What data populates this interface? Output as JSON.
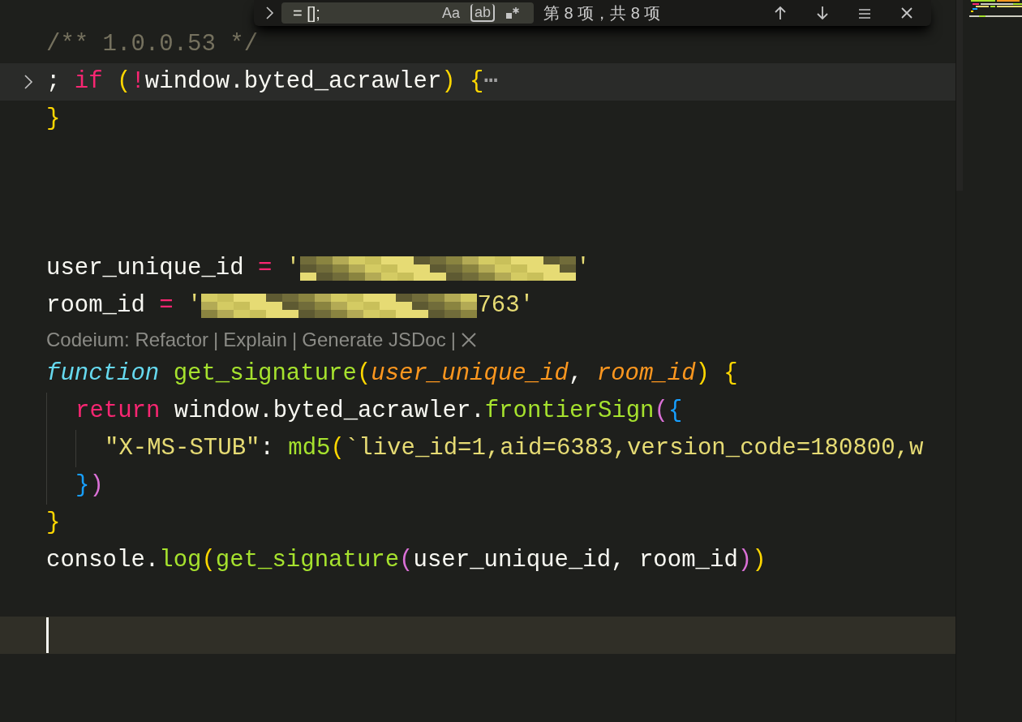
{
  "find_widget": {
    "query": "= [];",
    "options": [
      {
        "kind": "case",
        "label": "Aa",
        "selected": false
      },
      {
        "kind": "word",
        "label": "ab",
        "selected": false
      },
      {
        "kind": "regex",
        "selected": false
      }
    ],
    "result": "第 8 项，共 8 项"
  },
  "lines": [
    {
      "kind": "code",
      "tokens": [
        {
          "kind": "comment",
          "text": "/** 1.0.0.53 */"
        }
      ]
    },
    {
      "kind": "code",
      "folded": true,
      "highlight": true,
      "tokens": [
        {
          "kind": "plain",
          "text": "; "
        },
        {
          "kind": "keyword",
          "text": "if"
        },
        {
          "kind": "brace1",
          "text": " ("
        },
        {
          "kind": "keyword",
          "text": "!"
        },
        {
          "kind": "plain",
          "text": "window.byted_acrawler"
        },
        {
          "kind": "brace1",
          "text": ")"
        },
        {
          "kind": "brace1",
          "text": " {"
        },
        {
          "kind": "ellipsis",
          "text": "⋯"
        }
      ]
    },
    {
      "kind": "code",
      "tokens": [
        {
          "kind": "brace1",
          "text": "}"
        }
      ]
    },
    {
      "kind": "blank"
    },
    {
      "kind": "blank"
    },
    {
      "kind": "blank"
    },
    {
      "kind": "code",
      "tokens": [
        {
          "kind": "plain",
          "text": "user_unique_id "
        },
        {
          "kind": "keyword",
          "text": "="
        },
        {
          "kind": "string",
          "text": " '"
        },
        {
          "kind": "redacted"
        },
        {
          "kind": "string",
          "text": "'"
        }
      ]
    },
    {
      "kind": "code",
      "tokens": [
        {
          "kind": "plain",
          "text": "room_id "
        },
        {
          "kind": "keyword",
          "text": "="
        },
        {
          "kind": "string",
          "text": " '"
        },
        {
          "kind": "redacted"
        },
        {
          "kind": "string",
          "text": "763'"
        }
      ],
      "codelens": {
        "items": [
          "Codeium: Refactor",
          "Explain",
          "Generate JSDoc"
        ],
        "separator": "|"
      }
    },
    {
      "kind": "code",
      "tokens": [
        {
          "kind": "storage",
          "text": "function"
        },
        {
          "kind": "func",
          "text": " get_signature"
        },
        {
          "kind": "brace1",
          "text": "("
        },
        {
          "kind": "param",
          "text": "user_unique_id"
        },
        {
          "kind": "plain",
          "text": ", "
        },
        {
          "kind": "param",
          "text": "room_id"
        },
        {
          "kind": "brace1",
          "text": ")"
        },
        {
          "kind": "brace1",
          "text": " {"
        }
      ]
    },
    {
      "kind": "code",
      "tokens": [
        {
          "kind": "indent1"
        },
        {
          "kind": "keyword",
          "text": "return"
        },
        {
          "kind": "plain",
          "text": " window.byted_acrawler."
        },
        {
          "kind": "func",
          "text": "frontierSign"
        },
        {
          "kind": "brace2",
          "text": "("
        },
        {
          "kind": "brace3",
          "text": "{"
        }
      ]
    },
    {
      "kind": "code",
      "tokens": [
        {
          "kind": "indent2"
        },
        {
          "kind": "string",
          "text": "\"X-MS-STUB\""
        },
        {
          "kind": "plain",
          "text": ": "
        },
        {
          "kind": "func",
          "text": "md5"
        },
        {
          "kind": "brace1",
          "text": "("
        },
        {
          "kind": "string",
          "text": "`live_id=1,aid=6383,version_code=180800,w"
        }
      ]
    },
    {
      "kind": "code",
      "tokens": [
        {
          "kind": "indent1"
        },
        {
          "kind": "brace3",
          "text": "}"
        },
        {
          "kind": "brace2",
          "text": ")"
        }
      ]
    },
    {
      "kind": "code",
      "tokens": [
        {
          "kind": "brace1",
          "text": "}"
        }
      ]
    },
    {
      "kind": "code",
      "tokens": [
        {
          "kind": "plain",
          "text": "console."
        },
        {
          "kind": "func",
          "text": "log"
        },
        {
          "kind": "brace1",
          "text": "("
        },
        {
          "kind": "func",
          "text": "get_signature"
        },
        {
          "kind": "brace2",
          "text": "("
        },
        {
          "kind": "plain",
          "text": "user_unique_id, room_id"
        },
        {
          "kind": "brace2",
          "text": ")"
        },
        {
          "kind": "brace1",
          "text": ")"
        }
      ]
    },
    {
      "kind": "blank"
    },
    {
      "kind": "cursor"
    }
  ]
}
